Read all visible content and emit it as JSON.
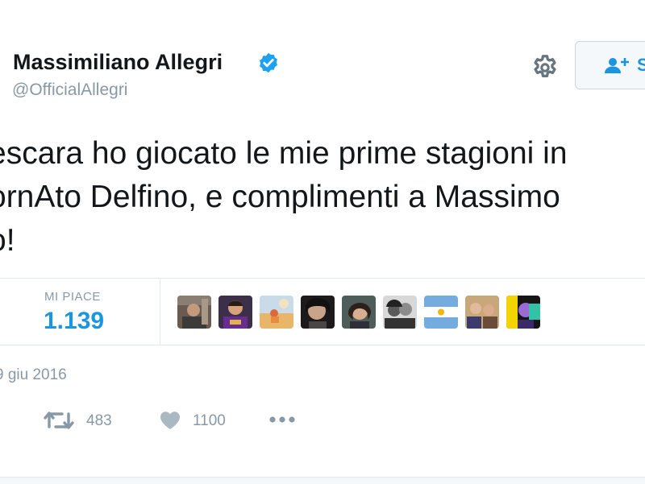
{
  "author": {
    "name": "Massimiliano Allegri",
    "handle": "@OfficialAllegri",
    "verified": true
  },
  "header": {
    "follow_label": "S"
  },
  "tweet": {
    "lines": [
      "escara ho giocato le mie prime stagioni in",
      "ornAto Delfino, e complimenti a Massimo",
      "o!"
    ]
  },
  "stats": {
    "likes_label": "MI PIACE",
    "likes_value": "1.139"
  },
  "timestamp": "9 giu 2016",
  "actions": {
    "retweet_count": "483",
    "like_count": "1100"
  },
  "colors": {
    "link_blue": "#1b95e0",
    "muted_gray": "#8899a6",
    "text": "#14171a",
    "border": "#e1e8ed"
  },
  "icons": {
    "verified": "verified-badge-icon",
    "settings": "gear-icon",
    "follow": "add-user-icon",
    "retweet": "retweet-icon",
    "like": "heart-icon",
    "more": "more-dots-icon"
  }
}
